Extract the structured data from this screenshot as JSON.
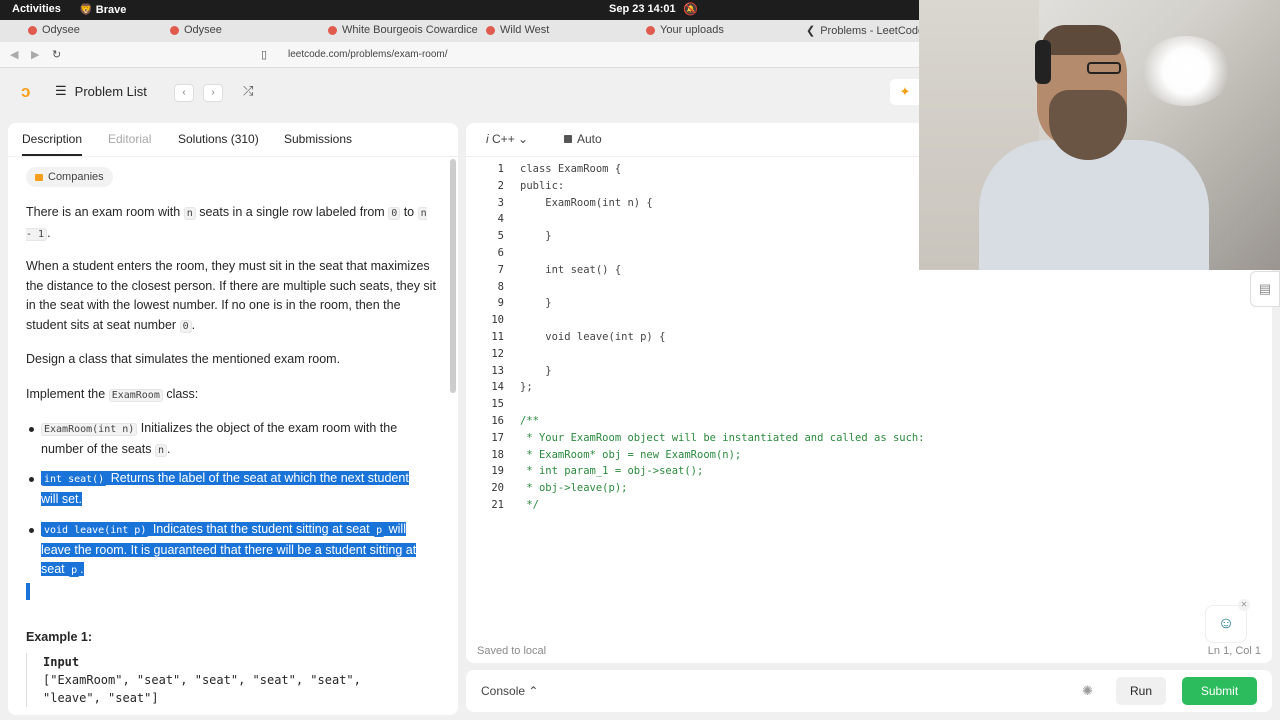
{
  "os": {
    "activities": "Activities",
    "app": "Brave",
    "clock": "Sep 23  14:01"
  },
  "browser": {
    "tabs": [
      "Odysee",
      "Odysee",
      "White Bourgeois Cowardice",
      "Wild West",
      "Your uploads",
      "Problems - LeetCode"
    ],
    "url": "leetcode.com/problems/exam-room/"
  },
  "header": {
    "problem_list": "Problem List"
  },
  "left_tabs": [
    "Description",
    "Editorial",
    "Solutions (310)",
    "Submissions"
  ],
  "description": {
    "companies": "Companies",
    "p1_a": "There is an exam room with ",
    "p1_code1": "n",
    "p1_b": " seats in a single row labeled from ",
    "p1_code2": "0",
    "p1_c": " to ",
    "p1_code3": "n - 1",
    "p1_d": ".",
    "p2_a": "When a student enters the room, they must sit in the seat that maximizes the distance to the closest person. If there are multiple such seats, they sit in the seat with the lowest number. If no one is in the room, then the student sits at seat number ",
    "p2_code": "0",
    "p2_b": ".",
    "p3": "Design a class that simulates the mentioned exam room.",
    "p4_a": "Implement the ",
    "p4_code": "ExamRoom",
    "p4_b": " class:",
    "li1_code": "ExamRoom(int n)",
    "li1_a": " Initializes the object of the exam room with the number of the seats ",
    "li1_code2": "n",
    "li1_b": ".",
    "li2_code": "int seat()",
    "li2_a": " Returns the label of the seat at which the next student will set.",
    "li3_code": "void leave(int p)",
    "li3_a": " Indicates that the student sitting at seat ",
    "li3_code2": "p",
    "li3_b": " will leave the room. It is guaranteed that there will be a student sitting at seat ",
    "li3_code3": "p",
    "li3_c": ".",
    "example_title": "Example 1:",
    "input_label": "Input",
    "input_line1": "[\"ExamRoom\", \"seat\", \"seat\", \"seat\", \"seat\",",
    "input_line2": "\"leave\", \"seat\"]"
  },
  "editor": {
    "language": "C++",
    "mode": "Auto",
    "lines": [
      "class ExamRoom {",
      "public:",
      "    ExamRoom(int n) {",
      "",
      "    }",
      "",
      "    int seat() {",
      "",
      "    }",
      "",
      "    void leave(int p) {",
      "",
      "    }",
      "};",
      "",
      "/**",
      " * Your ExamRoom object will be instantiated and called as such:",
      " * ExamRoom* obj = new ExamRoom(n);",
      " * int param_1 = obj->seat();",
      " * obj->leave(p);",
      " */"
    ],
    "line_numbers": [
      "1",
      "2",
      "3",
      "4",
      "5",
      "6",
      "7",
      "8",
      "9",
      "10",
      "11",
      "12",
      "13",
      "14",
      "15",
      "16",
      "17",
      "18",
      "19",
      "20",
      "21"
    ],
    "saved": "Saved to local",
    "position": "Ln 1, Col 1"
  },
  "bottom": {
    "console": "Console",
    "run": "Run",
    "submit": "Submit"
  },
  "colors": {
    "accent": "#f89f1b",
    "submit": "#2cbb5d",
    "selection": "#1a73d8"
  }
}
